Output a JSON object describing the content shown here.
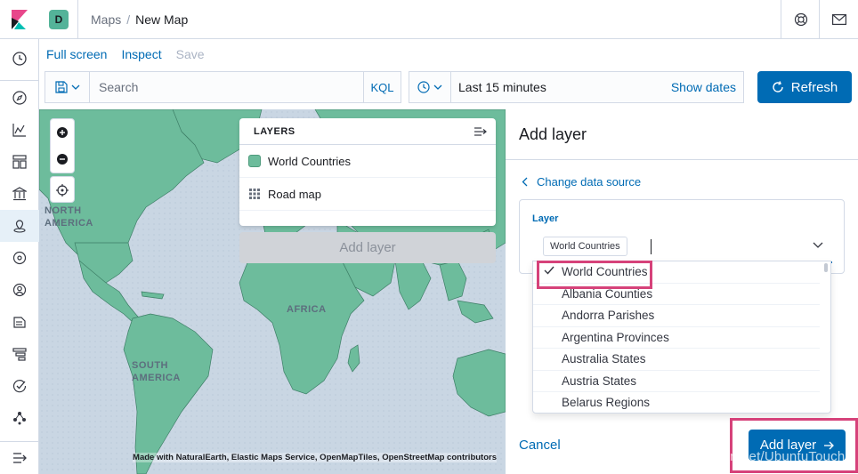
{
  "header": {
    "space_initial": "D",
    "breadcrumb_app": "Maps",
    "breadcrumb_page": "New Map"
  },
  "top_menu": {
    "full_screen": "Full screen",
    "inspect": "Inspect",
    "save": "Save"
  },
  "query": {
    "placeholder": "Search",
    "language": "KQL"
  },
  "time": {
    "range": "Last 15 minutes",
    "show_dates": "Show dates",
    "refresh": "Refresh"
  },
  "map": {
    "labels": {
      "north_america": "NORTH\nAMERICA",
      "south_america": "SOUTH\nAMERICA",
      "africa": "AFRICA"
    },
    "attribution": "Made with NaturalEarth, Elastic Maps Service, OpenMapTiles, OpenStreetMap contributors",
    "layers_title": "LAYERS",
    "layers": [
      {
        "name": "World Countries",
        "icon": "fill-swatch-icon"
      },
      {
        "name": "Road map",
        "icon": "tiles-icon"
      }
    ],
    "add_layer": "Add layer"
  },
  "flyout": {
    "title": "Add layer",
    "change_source": "Change data source",
    "layer_label": "Layer",
    "selected": "World Countries",
    "options": [
      "World Countries",
      "Albania Counties",
      "Andorra Parishes",
      "Argentina Provinces",
      "Australia States",
      "Austria States",
      "Belarus Regions"
    ],
    "cancel": "Cancel",
    "add_layer": "Add layer",
    "watermark": "https://blog.csdn.net/UbuntuTouch"
  },
  "colors": {
    "accent": "#006bb4",
    "land": "#6dbc9c",
    "ocean": "#c9d6e3",
    "highlight": "#d6427a"
  }
}
